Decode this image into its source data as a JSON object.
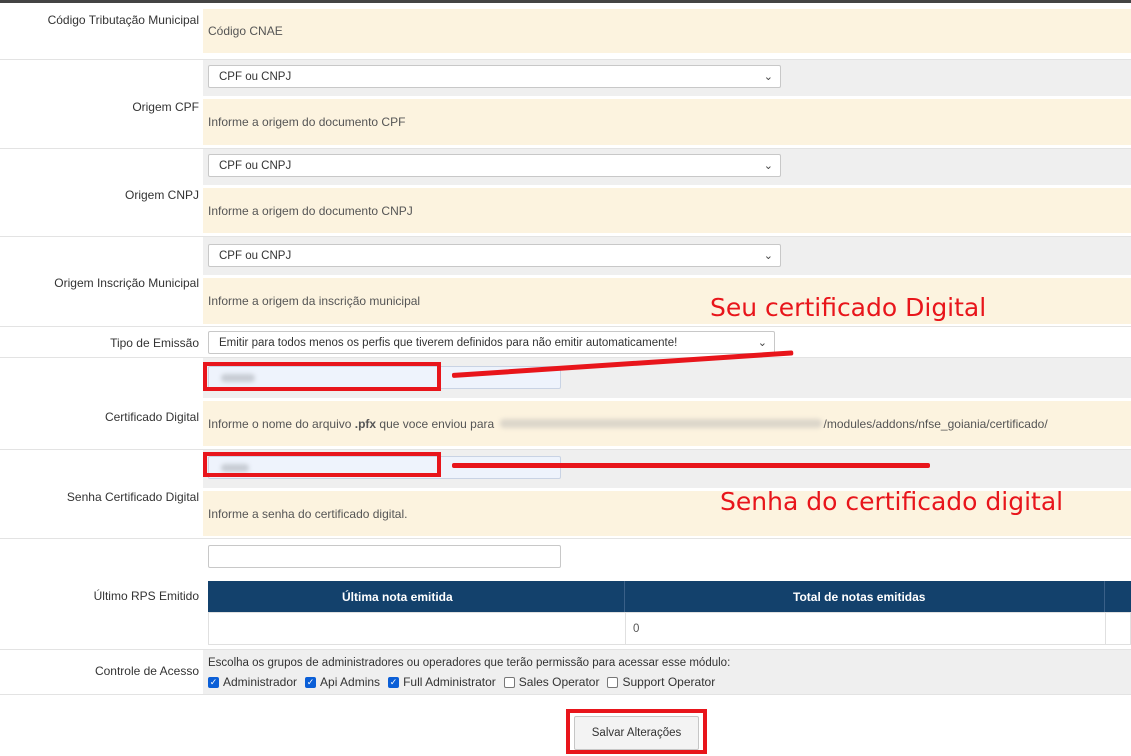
{
  "rows": {
    "codigo_tributacao": {
      "label": "Código Tributação Municipal",
      "help": "Código CNAE"
    },
    "origem_cpf": {
      "label": "Origem CPF",
      "selected": "CPF ou CNPJ",
      "help": "Informe a origem do documento CPF"
    },
    "origem_cnpj": {
      "label": "Origem CNPJ",
      "selected": "CPF ou CNPJ",
      "help": "Informe a origem do documento CNPJ"
    },
    "origem_inscricao": {
      "label": "Origem Inscrição Municipal",
      "selected": "CPF ou CNPJ",
      "help": "Informe a origem da inscrição municipal"
    },
    "tipo_emissao": {
      "label": "Tipo de Emissão",
      "selected": "Emitir para todos menos os perfis que tiverem definidos para não emitir automaticamente!"
    },
    "certificado": {
      "label": "Certificado Digital",
      "help_prefix": "Informe o nome do arquivo ",
      "help_bold": ".pfx",
      "help_mid": " que voce enviou para ",
      "help_suffix": "/modules/addons/nfse_goiania/certificado/"
    },
    "senha": {
      "label": "Senha Certificado Digital",
      "help": "Informe a senha do certificado digital."
    },
    "ultimo_rps": {
      "label": "Último RPS Emitido",
      "col1": "Última nota emitida",
      "col2": "Total de notas emitidas",
      "total_value": "0"
    },
    "controle": {
      "label": "Controle de Acesso",
      "instruction": "Escolha os grupos de administradores ou operadores que terão permissão para acessar esse módulo:",
      "groups": [
        {
          "name": "Administrador",
          "checked": true
        },
        {
          "name": "Api Admins",
          "checked": true
        },
        {
          "name": "Full Administrator",
          "checked": true
        },
        {
          "name": "Sales Operator",
          "checked": false
        },
        {
          "name": "Support Operator",
          "checked": false
        }
      ]
    }
  },
  "annotations": {
    "certificado": "Seu certificado Digital",
    "senha": "Senha do certificado digital"
  },
  "save_label": "Salvar Alterações",
  "colors": {
    "annotation_red": "#e8151b",
    "table_header": "#13416c",
    "help_bg": "#fcf3df",
    "checkbox": "#0b5fd7"
  }
}
